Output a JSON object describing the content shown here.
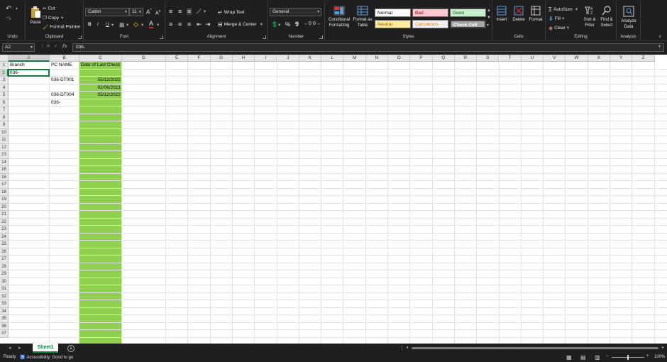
{
  "colors": {
    "accent": "#107c41",
    "highlight_fill": "#8fd14f",
    "dark_bg": "#1f1f1f"
  },
  "ribbon": {
    "undo_group": "Undo",
    "clipboard": {
      "paste": "Paste",
      "cut": "Cut",
      "copy": "Copy",
      "format_painter": "Format Painter",
      "label": "Clipboard"
    },
    "font": {
      "name": "Calibri",
      "size": "11",
      "bold": "B",
      "italic": "I",
      "underline": "U",
      "label": "Font",
      "grow": "A",
      "shrink": "A"
    },
    "alignment": {
      "wrap_text": "Wrap Text",
      "merge_center": "Merge & Center",
      "label": "Alignment"
    },
    "number": {
      "format": "General",
      "percent": "%",
      "comma": "9",
      "label": "Number"
    },
    "styles": {
      "conditional_formatting": "Conditional Formatting",
      "format_as_table": "Format as Table",
      "normal": "Normal",
      "bad": "Bad",
      "good": "Good",
      "neutral": "Neutral",
      "calculation": "Calculation",
      "check_cell": "Check Cell",
      "label": "Styles"
    },
    "cells": {
      "insert": "Insert",
      "delete": "Delete",
      "format": "Format",
      "label": "Cells"
    },
    "editing": {
      "autosum": "AutoSum",
      "fill": "Fill",
      "clear": "Clear",
      "sort_filter": "Sort & Filter",
      "find_select": "Find & Select",
      "label": "Editing"
    },
    "analysis": {
      "analyze_data": "Analyze Data",
      "label": "Analysis"
    }
  },
  "formula_bar": {
    "name_box": "A2",
    "fx": "fx",
    "value": "036-"
  },
  "grid": {
    "columns": [
      "A",
      "B",
      "C",
      "D",
      "E",
      "F",
      "G",
      "H",
      "I",
      "J",
      "K",
      "L",
      "M",
      "N",
      "O",
      "P",
      "Q",
      "R",
      "S",
      "T",
      "U",
      "V",
      "W",
      "X",
      "Y",
      "Z"
    ],
    "row_count": 37,
    "selected_col": "A",
    "selected_row": 2,
    "cells": [
      {
        "ref": "A1",
        "value": "Branch"
      },
      {
        "ref": "B1",
        "value": "PC NAME"
      },
      {
        "ref": "C1",
        "value": "Date of Last Check"
      },
      {
        "ref": "A2",
        "value": "036-"
      },
      {
        "ref": "B3",
        "value": "036-DT001"
      },
      {
        "ref": "C3",
        "value": "05/12/2022"
      },
      {
        "ref": "C4",
        "value": "02/06/2021"
      },
      {
        "ref": "B5",
        "value": "036-DT004"
      },
      {
        "ref": "C5",
        "value": "05/12/2022"
      },
      {
        "ref": "B6",
        "value": "036-"
      }
    ]
  },
  "sheet_tabs": {
    "active": "Sheet1",
    "add": "+"
  },
  "status_bar": {
    "ready": "Ready",
    "accessibility": "Accessibility: Good to go",
    "zoom": "100%"
  }
}
